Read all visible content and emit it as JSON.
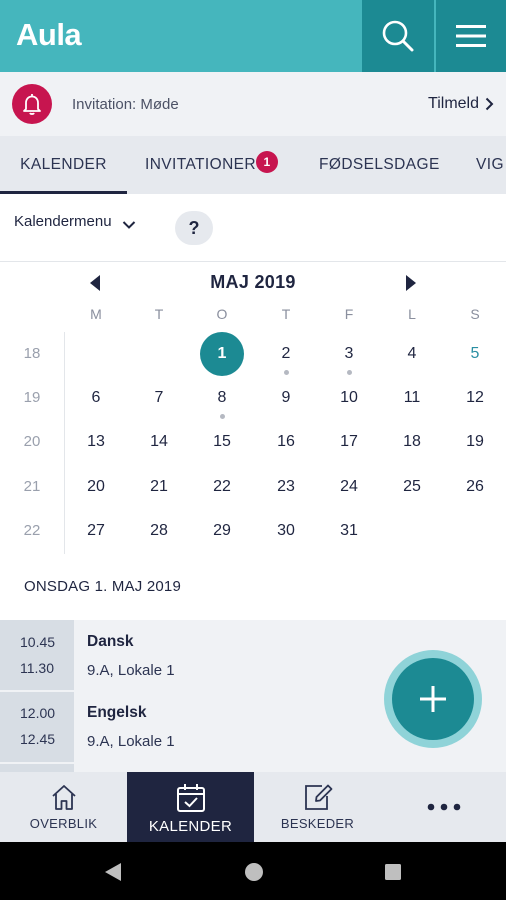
{
  "app": {
    "logo": "Aula"
  },
  "header": {
    "search_icon": "search-icon",
    "menu_icon": "hamburger-menu-icon"
  },
  "notification": {
    "icon": "bell-icon",
    "text": "Invitation: Møde",
    "action": "Tilmeld"
  },
  "tabs": [
    {
      "label": "KALENDER",
      "active": true
    },
    {
      "label": "INVITATIONER",
      "badge": "1"
    },
    {
      "label": "FØDSELSDAGE"
    },
    {
      "label": "VIG"
    }
  ],
  "calendar_menu": {
    "label": "Kalendermenu",
    "help": "?"
  },
  "month": {
    "title": "MAJ 2019",
    "weekdays": [
      "M",
      "T",
      "O",
      "T",
      "F",
      "L",
      "S"
    ],
    "weeks": [
      {
        "number": "18",
        "days": [
          "",
          "",
          "1",
          "2",
          "3",
          "4",
          "5"
        ]
      },
      {
        "number": "19",
        "days": [
          "6",
          "7",
          "8",
          "9",
          "10",
          "11",
          "12"
        ]
      },
      {
        "number": "20",
        "days": [
          "13",
          "14",
          "15",
          "16",
          "17",
          "18",
          "19"
        ]
      },
      {
        "number": "21",
        "days": [
          "20",
          "21",
          "22",
          "23",
          "24",
          "25",
          "26"
        ]
      },
      {
        "number": "22",
        "days": [
          "27",
          "28",
          "29",
          "30",
          "31",
          "",
          ""
        ]
      }
    ],
    "selected_day": "1",
    "days_with_events": [
      "2",
      "3",
      "8"
    ]
  },
  "selected_date_heading": "ONSDAG 1. MAJ 2019",
  "events": [
    {
      "start": "10.45",
      "end": "11.30",
      "title": "Dansk",
      "location": "9.A, Lokale 1"
    },
    {
      "start": "12.00",
      "end": "12.45",
      "title": "Engelsk",
      "location": "9.A, Lokale 1"
    }
  ],
  "fab": {
    "icon": "plus-icon"
  },
  "bottom_nav": [
    {
      "label": "OVERBLIK",
      "icon": "home-icon"
    },
    {
      "label": "KALENDER",
      "icon": "calendar-check-icon",
      "active": true
    },
    {
      "label": "BESKEDER",
      "icon": "compose-icon"
    },
    {
      "label": "",
      "icon": "more-dots-icon"
    }
  ],
  "system_nav": {
    "back": "back-triangle-icon",
    "home": "home-circle-icon",
    "recents": "recents-square-icon"
  },
  "colors": {
    "teal": "#45b6bd",
    "dark_teal": "#1c8a93",
    "navy": "#1f2540",
    "alert": "#c7154f"
  }
}
